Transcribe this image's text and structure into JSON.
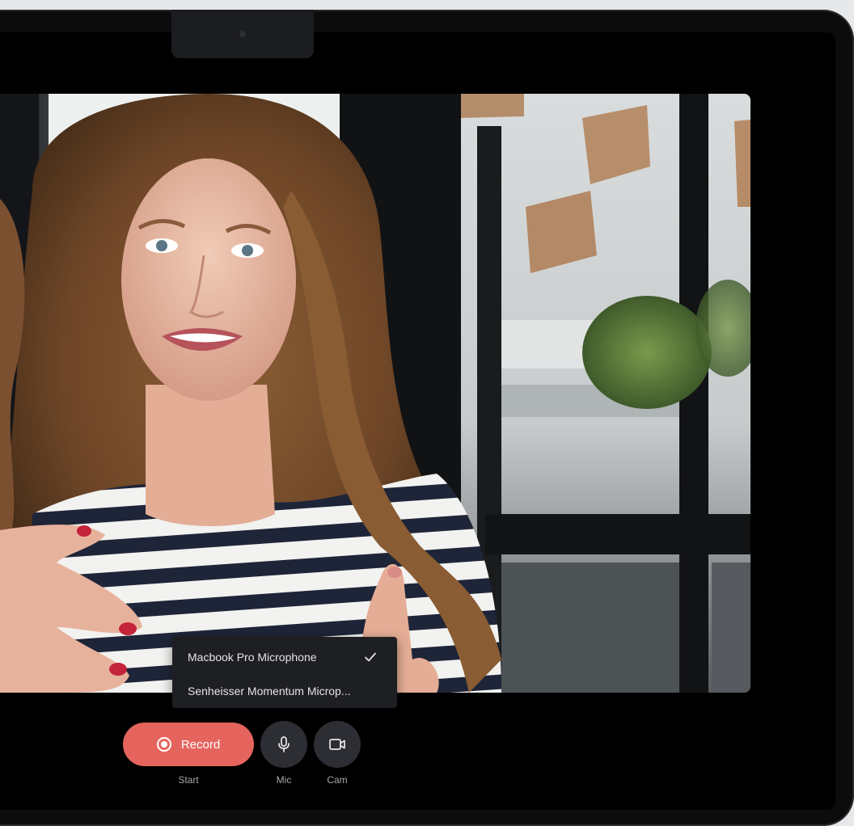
{
  "mic_menu": {
    "options": [
      {
        "label": "Macbook Pro Microphone",
        "selected": true
      },
      {
        "label": "Senheisser Momentum Microp...",
        "selected": false
      }
    ]
  },
  "controls": {
    "record_label": "Record",
    "record_caption": "Start",
    "mic_caption": "Mic",
    "cam_caption": "Cam"
  },
  "icons": {
    "record": "record-dot-icon",
    "mic": "microphone-icon",
    "cam": "video-camera-icon",
    "check": "check-icon"
  },
  "colors": {
    "record_button": "#e5655e",
    "round_button": "#2d2e33",
    "menu_background": "#1e1f22"
  }
}
